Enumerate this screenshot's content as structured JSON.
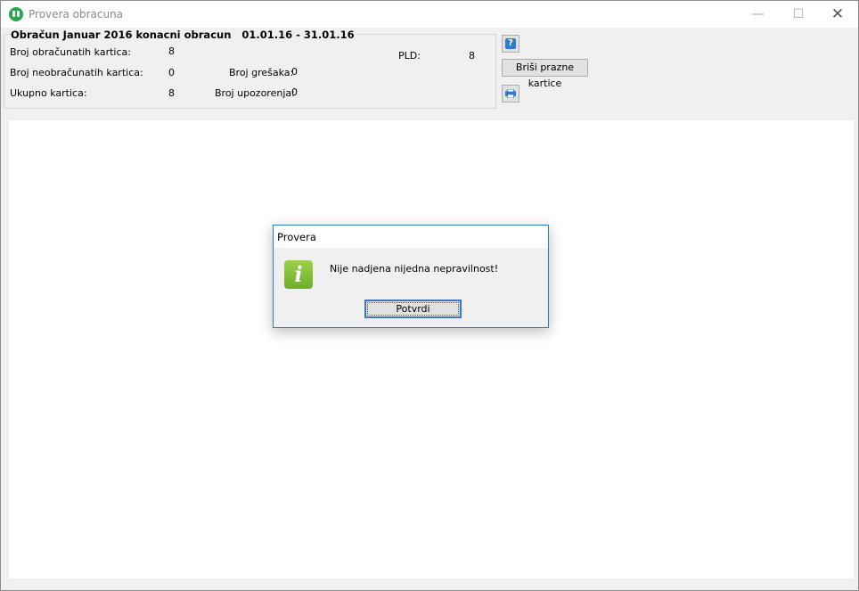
{
  "window": {
    "title": "Provera obracuna",
    "min_glyph": "—",
    "max_glyph": "☐",
    "close_glyph": "✕"
  },
  "summary": {
    "group_title": "Obračun Januar 2016 konacni obracun   01.01.16 - 31.01.16",
    "labels": {
      "calculated": "Broj obračunatih kartica:",
      "uncalculated": "Broj neobračunatih kartica:",
      "total": "Ukupno kartica:",
      "errors": "Broj grešaka:",
      "warnings": "Broj upozorenja:",
      "pld": "PLD:"
    },
    "values": {
      "calculated": "8",
      "uncalculated": "0",
      "total": "8",
      "errors": "0",
      "warnings": "0",
      "pld": "8"
    }
  },
  "toolbar": {
    "help_glyph": "?",
    "delete_empty_label": "Briši prazne kartice"
  },
  "dialog": {
    "title": "Provera",
    "icon_glyph": "i",
    "message": "Nije nadjena nijedna nepravilnost!",
    "confirm_label": "Potvrdi"
  },
  "colors": {
    "dialog_border": "#2b79d0",
    "info_icon": "#8bc34a",
    "app_icon": "#27a84a",
    "help_icon": "#2f7bd4"
  }
}
